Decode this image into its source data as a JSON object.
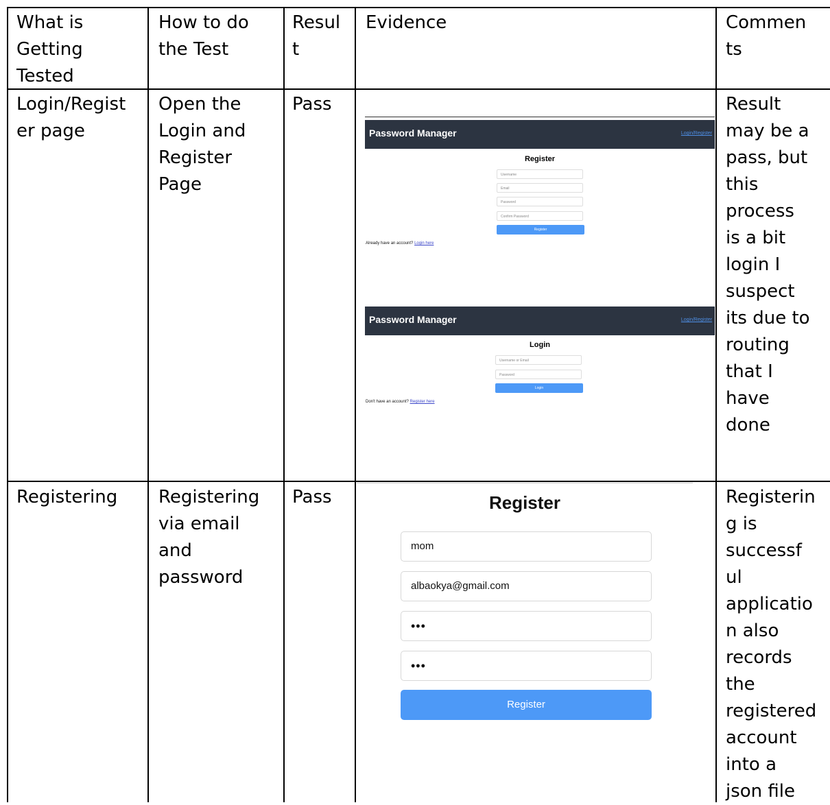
{
  "headers": {
    "what": "What is\nGetting\nTested",
    "how": "How to do\nthe Test",
    "result": "Resul\nt",
    "evidence": "Evidence",
    "comments": "Commen\nts"
  },
  "rows": [
    {
      "what": "Login/Regist\ner page",
      "how": "Open the\nLogin and\nRegister\nPage",
      "result": "Pass",
      "comments": "Result\nmay be a\npass, but\nthis\nprocess\nis a bit\nlogin I\nsuspect\nits due to\nrouting\nthat I\nhave\ndone"
    },
    {
      "what": "Registering",
      "how": "Registering\nvia email\nand\npassword",
      "result": "Pass",
      "comments": "Registerin\ng is\nsuccessf\nul\napplicatio\nn also\nrecords\nthe\nregistered\naccount\ninto a\njson file"
    }
  ],
  "register_shot": {
    "brand": "Password Manager",
    "nav_link": "Login/Register",
    "title": "Register",
    "username_ph": "Username",
    "email_ph": "Email",
    "password_ph": "Password",
    "confirm_ph": "Confirm Password",
    "button": "Register",
    "footer_text": "Already have an account? ",
    "footer_link": "Login here"
  },
  "login_shot": {
    "brand": "Password Manager",
    "nav_link": "Login/Register",
    "title": "Login",
    "user_ph": "Username or Email",
    "password_ph": "Password",
    "button": "Login",
    "footer_text": "Don't have an account? ",
    "footer_link": "Register here"
  },
  "register_filled": {
    "title": "Register",
    "username": "mom",
    "email": "albaokya@gmail.com",
    "password": "•••",
    "confirm": "•••",
    "button": "Register"
  }
}
